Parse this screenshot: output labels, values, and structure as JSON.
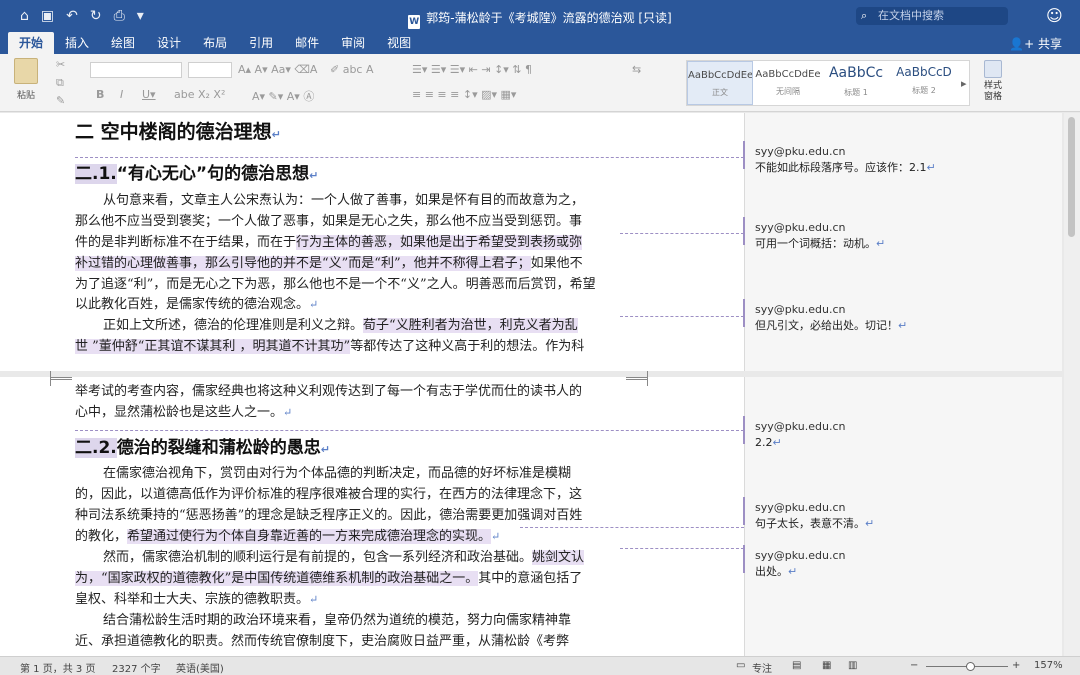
{
  "window": {
    "title": "郭筠-蒲松龄于《考城隍》流露的德治观 [只读]",
    "doc_icon": "W",
    "search_placeholder": "在文档中搜索"
  },
  "titlebar_icons": [
    "home-icon",
    "save-icon",
    "undo-icon",
    "redo-icon",
    "print-icon",
    "customize-icon"
  ],
  "tabs": [
    "开始",
    "插入",
    "绘图",
    "设计",
    "布局",
    "引用",
    "邮件",
    "审阅",
    "视图"
  ],
  "share_label": "共享",
  "ribbon": {
    "paste_label": "粘贴",
    "styles": [
      {
        "sample": "AaBbCcDdEe",
        "name": "正文"
      },
      {
        "sample": "AaBbCcDdEe",
        "name": "无间隔"
      },
      {
        "sample": "AaBbCc",
        "name": "标题 1"
      },
      {
        "sample": "AaBbCcD",
        "name": "标题 2"
      }
    ],
    "style_pane_label": "样式\n窗格"
  },
  "page1": {
    "heading": "二 空中楼阁的德治理想",
    "sub_num": "二.1.",
    "sub_title": "“有心无心”句的德治思想",
    "lines": [
      "从句意来看，文章主人公宋焘认为：一个人做了善事，如果是怀有目的而故意为之，",
      "那么他不应当受到褒奖；一个人做了恶事，如果是无心之失，那么他不应当受到惩罚。事",
      "件的是非判断标准不在于结果，而在于",
      "行为主体的善恶，如果他是出于希望受到表扬或弥",
      "补过错的心理做善事，那么引导他的并不是“义”而是“利”，他并不称得上君子；",
      "如果他不",
      "为了追逐“利”，而是无心之下为恶，那么他也不是一个不“义”之人。明善恶而后赏罚，希望",
      "以此教化百姓，是儒家传统的德治观念。",
      "正如上文所述，德治的伦理准则是利义之辩。",
      "荀子“义胜利者为治世，利克义者为乱",
      "世 ”董仲舒“正其谊不谋其利 ，明其道不计其功”",
      "等都传达了这种义高于利的想法。作为科"
    ]
  },
  "page2": {
    "lines_a": [
      "举考试的考查内容，儒家经典也将这种义利观传达到了每一个有志于学优而仕的读书人的",
      "心中，显然蒲松龄也是这些人之一。"
    ],
    "sub_num": "二.2.",
    "sub_title": "德治的裂缝和蒲松龄的愚忠",
    "lines_b": [
      "在儒家德治视角下，赏罚由对行为个体品德的判断决定，而品德的好坏标准是模糊",
      "的，因此，以道德高低作为评价标准的程序很难被合理的实行，在西方的法律理念下，这",
      "种司法系统秉持的“惩恶扬善”的理念是缺乏程序正义的。因此，德治需要更加强调对百姓",
      "的教化，",
      "希望通过使行为个体自身靠近善的一方来完成德治理念的实现。",
      "然而，儒家德治机制的顺利运行是有前提的，包含一系列经济和政治基础。",
      "姚剑文认",
      "为，“国家政权的道德教化”是中国传统道德维系机制的政治基础之一。",
      "其中的意涵包括了",
      "皇权、科举和士大夫、宗族的德教职责。",
      "结合蒲松龄生活时期的政治环境来看，皇帝仍然为道统的模范，努力向儒家精神靠",
      "近、承担道德教化的职责。然而传统官僚制度下，吏治腐败日益严重，从蒲松龄《考弊"
    ]
  },
  "comments": [
    {
      "author": "syy@pku.edu.cn",
      "text": "不能如此标段落序号。应该作：2.1"
    },
    {
      "author": "syy@pku.edu.cn",
      "text": "可用一个词概括：动机。"
    },
    {
      "author": "syy@pku.edu.cn",
      "text": "但凡引文，必给出处。切记！"
    },
    {
      "author": "syy@pku.edu.cn",
      "text": "2.2"
    },
    {
      "author": "syy@pku.edu.cn",
      "text": "句子太长，表意不清。"
    },
    {
      "author": "syy@pku.edu.cn",
      "text": "出处。"
    }
  ],
  "status": {
    "page": "第 1 页，共 3 页",
    "words": "2327 个字",
    "language": "英语(美国)",
    "focus": "专注",
    "zoom": "157%"
  },
  "colors": {
    "accent": "#2b579a",
    "comment": "#9d8fc4",
    "highlight": "#e8dff3"
  }
}
